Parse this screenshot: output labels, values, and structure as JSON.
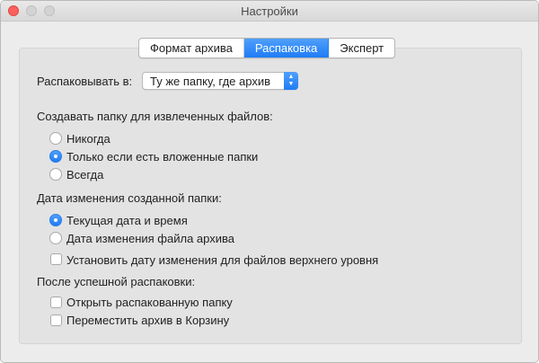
{
  "window": {
    "title": "Настройки"
  },
  "tabs": [
    {
      "label": "Формат архива",
      "active": false
    },
    {
      "label": "Распаковка",
      "active": true
    },
    {
      "label": "Эксперт",
      "active": false
    }
  ],
  "extract_to": {
    "label": "Распаковывать в:",
    "selected": "Ту же папку, где архив"
  },
  "create_folder": {
    "heading": "Создавать папку для извлеченных файлов:",
    "options": [
      "Никогда",
      "Только если есть вложенные папки",
      "Всегда"
    ],
    "selected_index": 1
  },
  "folder_date": {
    "heading": "Дата изменения созданной папки:",
    "options": [
      "Текущая дата и время",
      "Дата изменения файла архива"
    ],
    "selected_index": 0,
    "checkbox_label": "Установить дату изменения для файлов верхнего уровня",
    "checkbox_checked": false
  },
  "after_success": {
    "heading": "После успешной распаковки:",
    "checkboxes": [
      {
        "label": "Открыть распакованную папку",
        "checked": false
      },
      {
        "label": "Переместить архив в Корзину",
        "checked": false
      }
    ]
  },
  "colors": {
    "accent": "#1f7cf6",
    "close_button": "#fc605c",
    "panel": "#e3e3e3"
  }
}
